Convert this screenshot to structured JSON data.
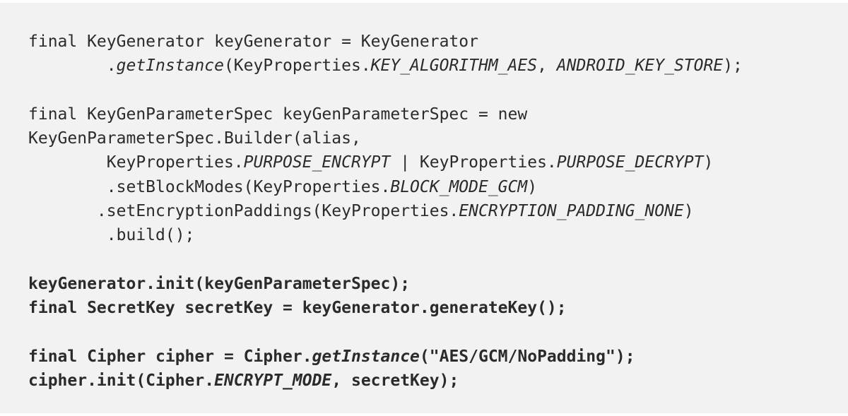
{
  "code_block": {
    "lines": [
      [
        {
          "text": "final KeyGenerator keyGenerator = KeyGenerator",
          "style": "n"
        }
      ],
      [
        {
          "text": "        .",
          "style": "n"
        },
        {
          "text": "getInstance",
          "style": "i"
        },
        {
          "text": "(KeyProperties.",
          "style": "n"
        },
        {
          "text": "KEY_ALGORITHM_AES",
          "style": "i"
        },
        {
          "text": ", ",
          "style": "n"
        },
        {
          "text": "ANDROID_KEY_STORE",
          "style": "i"
        },
        {
          "text": ");",
          "style": "n"
        }
      ],
      [],
      [
        {
          "text": "final KeyGenParameterSpec keyGenParameterSpec = new",
          "style": "n"
        }
      ],
      [
        {
          "text": "KeyGenParameterSpec.Builder(alias,",
          "style": "n"
        }
      ],
      [
        {
          "text": "        KeyProperties.",
          "style": "n"
        },
        {
          "text": "PURPOSE_ENCRYPT",
          "style": "i"
        },
        {
          "text": " | KeyProperties.",
          "style": "n"
        },
        {
          "text": "PURPOSE_DECRYPT",
          "style": "i"
        },
        {
          "text": ")",
          "style": "n"
        }
      ],
      [
        {
          "text": "        .setBlockModes(KeyProperties.",
          "style": "n"
        },
        {
          "text": "BLOCK_MODE_GCM",
          "style": "i"
        },
        {
          "text": ")",
          "style": "n"
        }
      ],
      [
        {
          "text": "       .setEncryptionPaddings(KeyProperties.",
          "style": "n"
        },
        {
          "text": "ENCRYPTION_PADDING_NONE",
          "style": "i"
        },
        {
          "text": ")",
          "style": "n"
        }
      ],
      [
        {
          "text": "        .build();",
          "style": "n"
        }
      ],
      [],
      [
        {
          "text": "keyGenerator.init(keyGenParameterSpec);",
          "style": "b"
        }
      ],
      [
        {
          "text": "final SecretKey secretKey = keyGenerator.generateKey();",
          "style": "b"
        }
      ],
      [],
      [
        {
          "text": "final Cipher cipher = Cipher.",
          "style": "b"
        },
        {
          "text": "getInstance",
          "style": "bi"
        },
        {
          "text": "(\"AES/GCM/NoPadding\");",
          "style": "b"
        }
      ],
      [
        {
          "text": "cipher.init(Cipher.",
          "style": "b"
        },
        {
          "text": "ENCRYPT_MODE",
          "style": "bi"
        },
        {
          "text": ", secretKey);",
          "style": "b"
        }
      ]
    ]
  }
}
